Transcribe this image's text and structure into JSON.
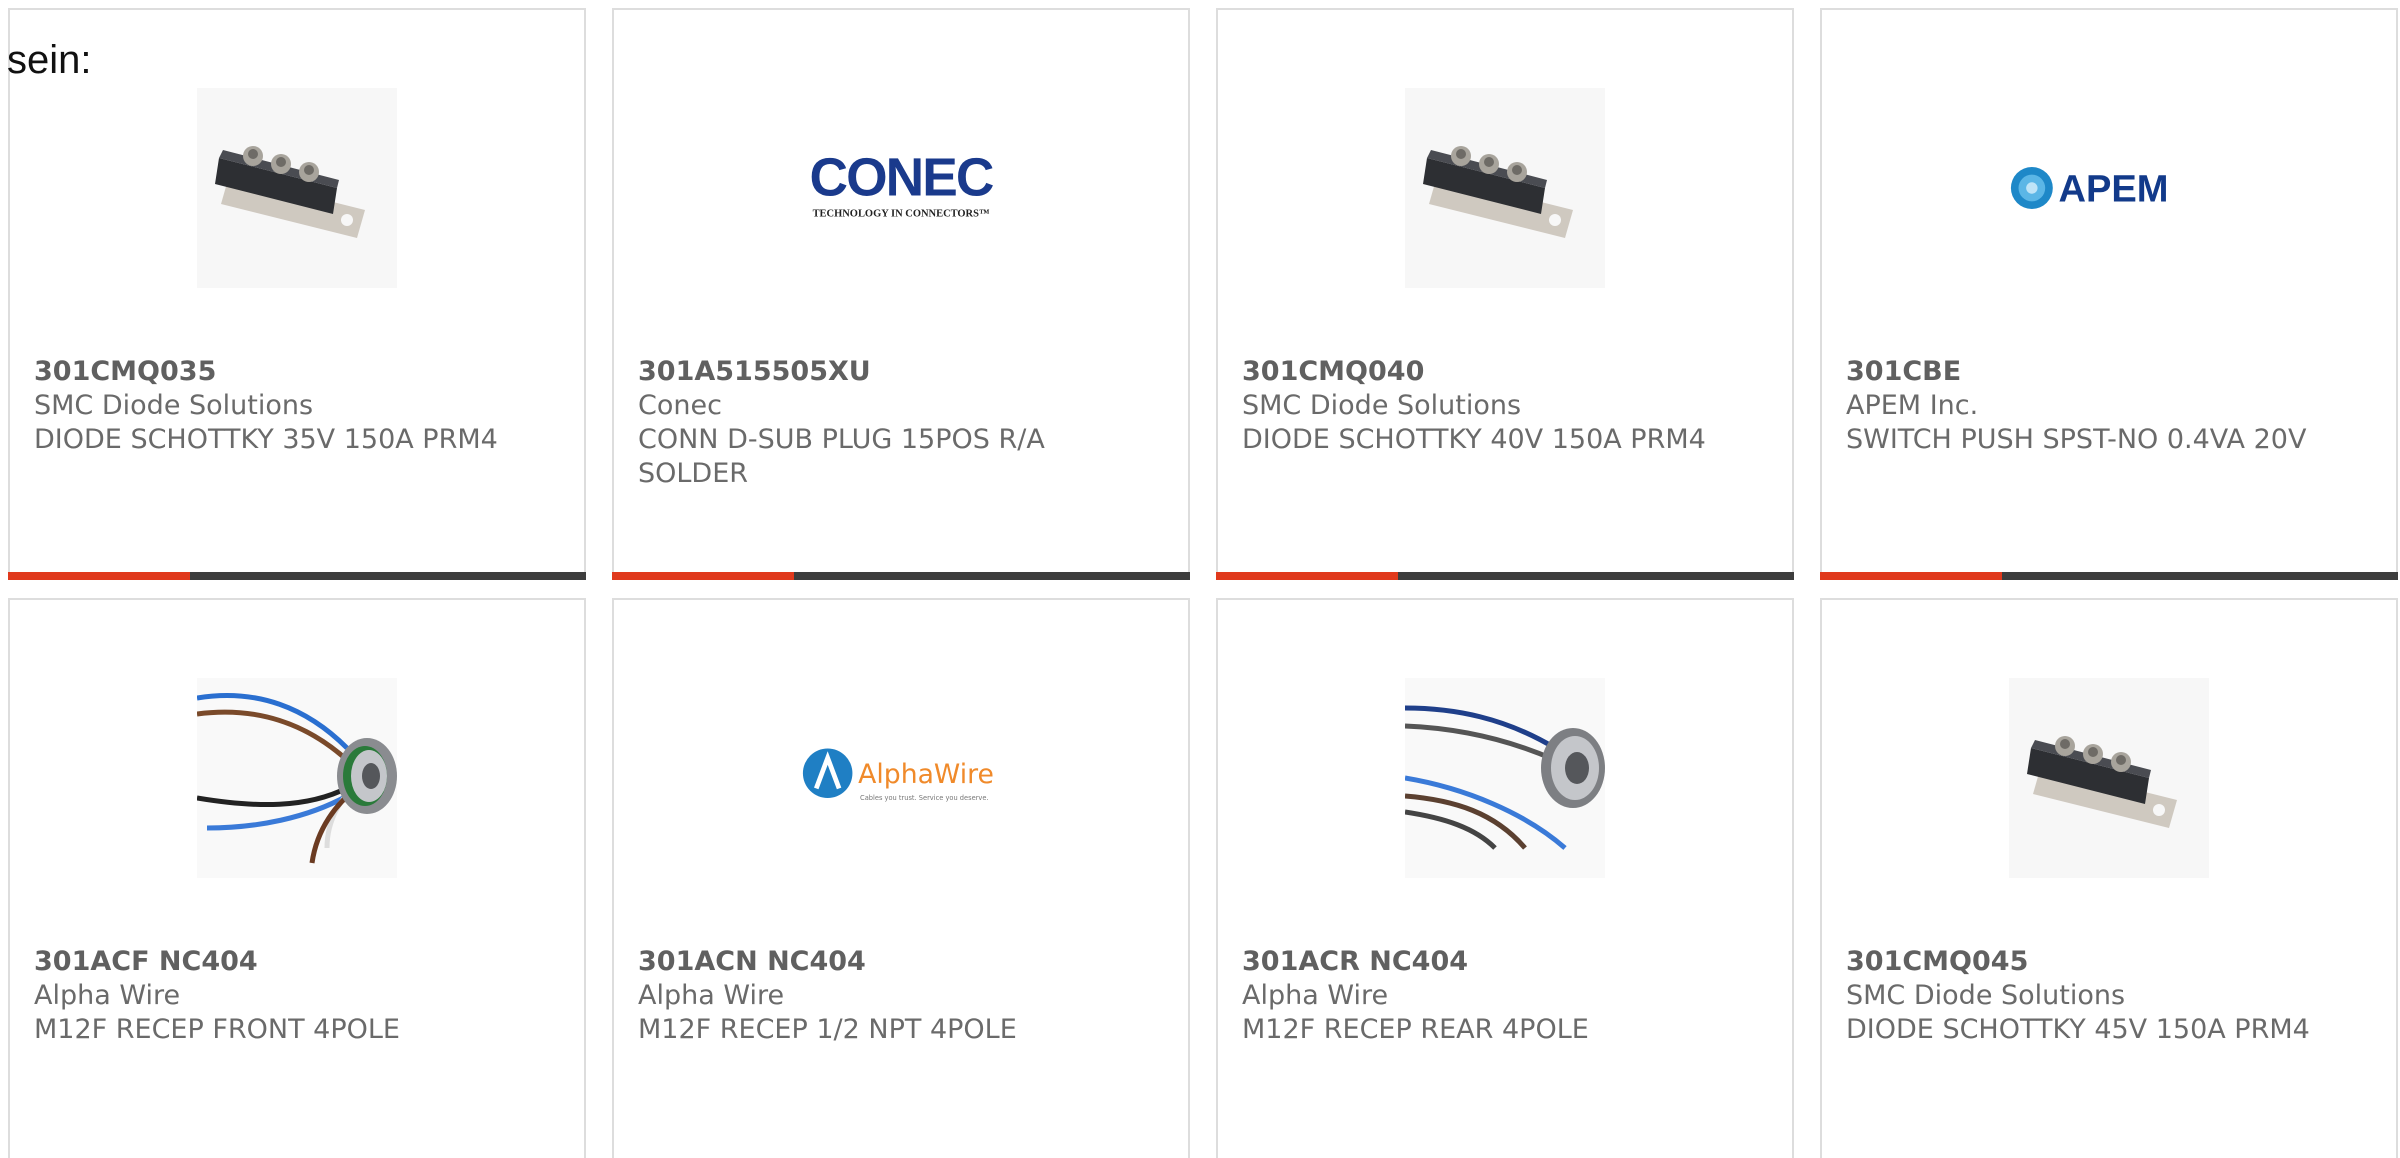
{
  "intro_text": "sein:",
  "products": [
    {
      "part_number": "301CMQ035",
      "manufacturer": "SMC Diode Solutions",
      "description": "DIODE SCHOTTKY 35V 150A PRM4",
      "image_icon": "diode-module-icon"
    },
    {
      "part_number": "301A515505XU",
      "manufacturer": "Conec",
      "description": "CONN D-SUB PLUG 15POS R/A SOLDER",
      "image_icon": "conec-logo",
      "logo_text": "CONEC",
      "logo_tagline": "TECHNOLOGY IN CONNECTORS™"
    },
    {
      "part_number": "301CMQ040",
      "manufacturer": "SMC Diode Solutions",
      "description": "DIODE SCHOTTKY 40V 150A PRM4",
      "image_icon": "diode-module-icon"
    },
    {
      "part_number": "301CBE",
      "manufacturer": "APEM Inc.",
      "description": "SWITCH PUSH SPST-NO 0.4VA 20V",
      "image_icon": "apem-logo",
      "logo_text": "APEM"
    },
    {
      "part_number": "301ACF NC404",
      "manufacturer": "Alpha Wire",
      "description": "M12F RECEP FRONT 4POLE",
      "image_icon": "m12-connector-icon"
    },
    {
      "part_number": "301ACN NC404",
      "manufacturer": "Alpha Wire",
      "description": "M12F RECEP 1/2 NPT 4POLE",
      "image_icon": "alphawire-logo",
      "logo_text": "AlphaWire",
      "logo_tagline": "Cables you trust. Service you deserve."
    },
    {
      "part_number": "301ACR NC404",
      "manufacturer": "Alpha Wire",
      "description": "M12F RECEP REAR 4POLE",
      "image_icon": "m12-connector-icon"
    },
    {
      "part_number": "301CMQ045",
      "manufacturer": "SMC Diode Solutions",
      "description": "DIODE SCHOTTKY 45V 150A PRM4",
      "image_icon": "diode-module-icon"
    }
  ],
  "colors": {
    "accent": "#e0391c",
    "bar": "#3d3d3d",
    "border": "#dddddd",
    "text": "#6a6a6a"
  }
}
